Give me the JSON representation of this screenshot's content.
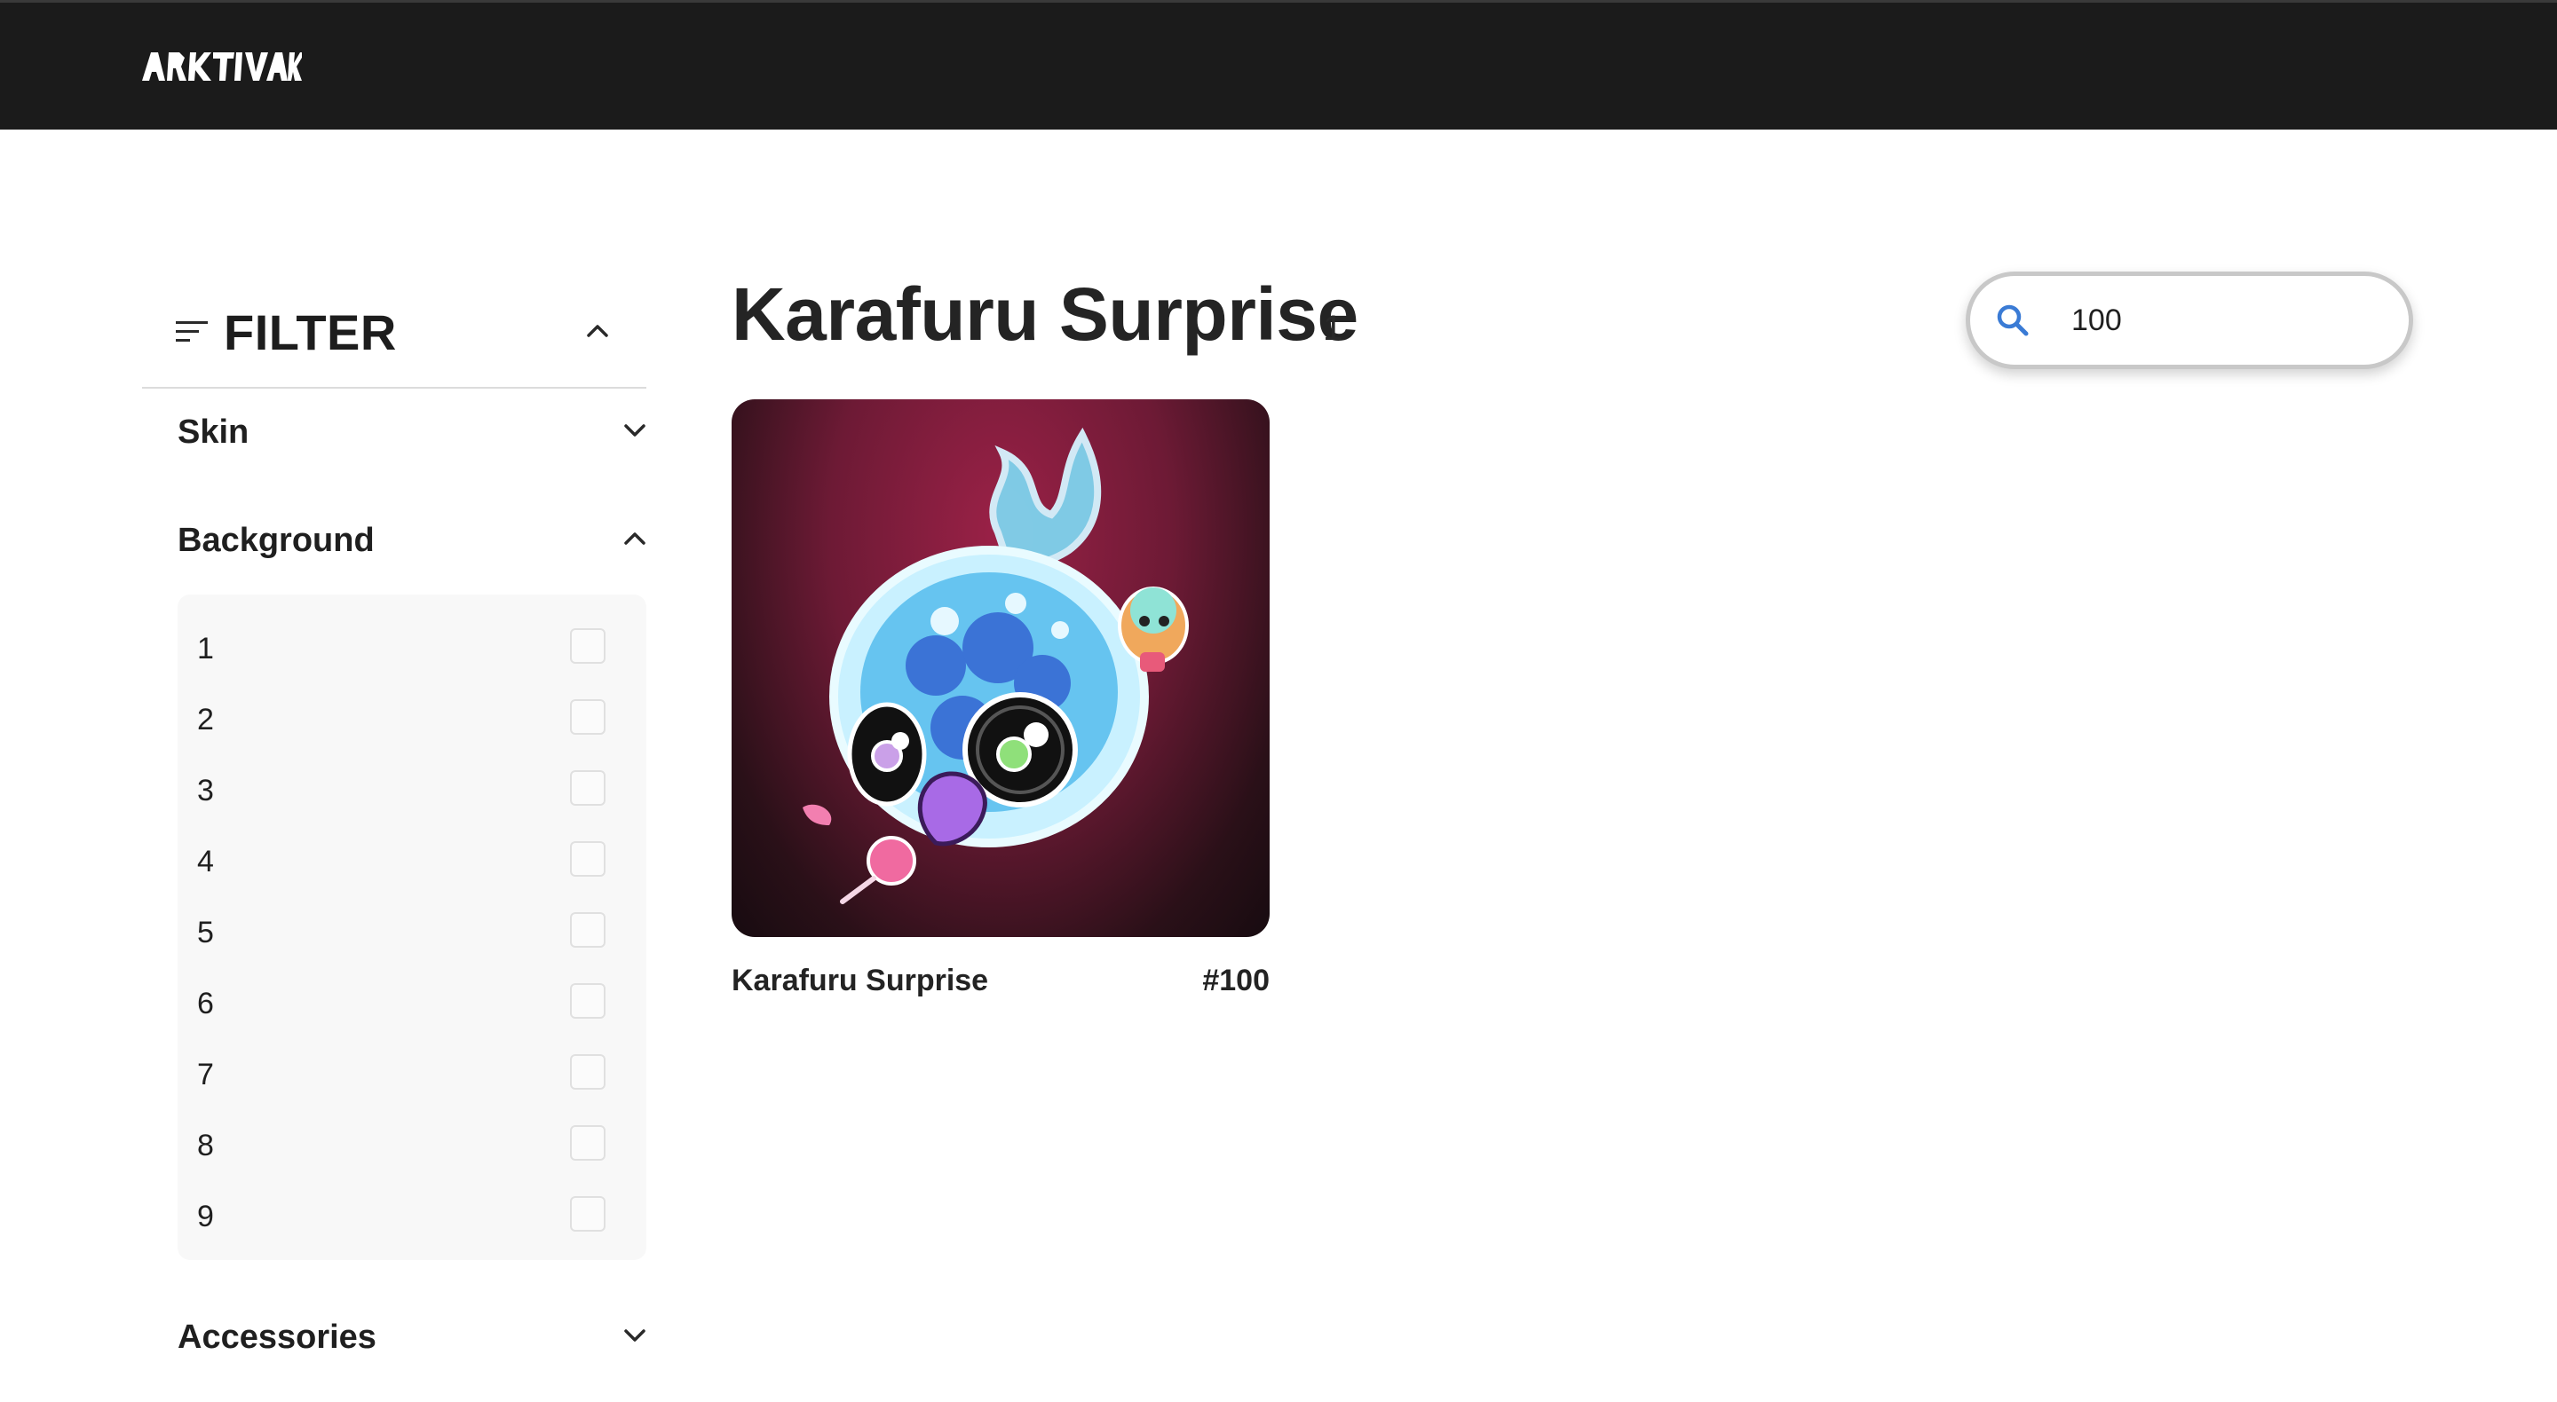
{
  "header": {
    "logo_text": "ARKTIVAK"
  },
  "sidebar": {
    "filter_title": "FILTER",
    "sections": [
      {
        "label": "Skin",
        "expanded": false
      },
      {
        "label": "Background",
        "expanded": true,
        "options": [
          "1",
          "2",
          "3",
          "4",
          "5",
          "6",
          "7",
          "8",
          "9"
        ]
      },
      {
        "label": "Accessories",
        "expanded": false
      }
    ]
  },
  "main": {
    "title": "Karafuru Surprise",
    "count": "1",
    "search": {
      "value": "100",
      "placeholder": ""
    },
    "items": [
      {
        "name": "Karafuru Surprise",
        "id": "#100"
      }
    ]
  },
  "colors": {
    "topbar": "#1b1b1b",
    "card_background": "#8e1f43",
    "search_icon": "#3a7bd5"
  },
  "icons": [
    "filter-lines-icon",
    "chevron-up-icon",
    "chevron-down-icon",
    "search-icon"
  ]
}
